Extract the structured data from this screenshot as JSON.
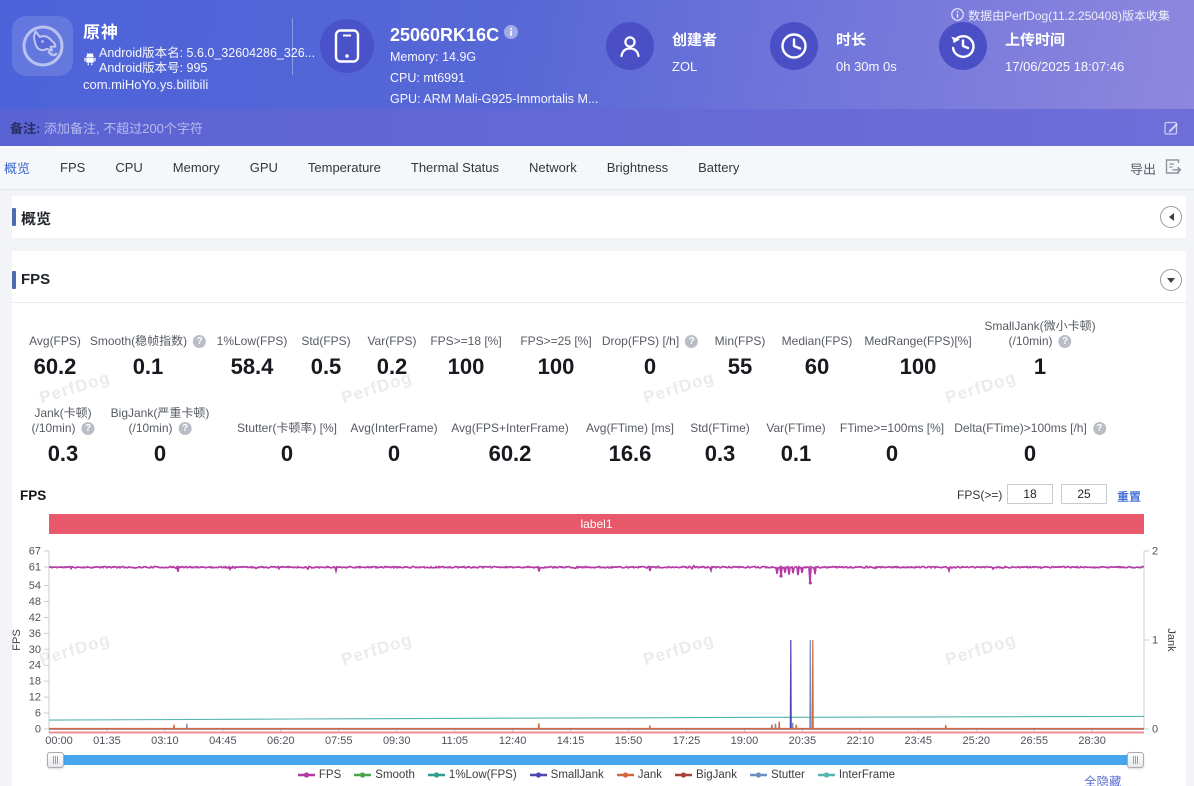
{
  "header": {
    "app": {
      "name": "原神",
      "android_version_name": "Android版本名: 5.6.0_32604286_326...",
      "android_version_code": "Android版本号: 995",
      "package": "com.miHoYo.ys.bilibili"
    },
    "device": {
      "model": "25060RK16C",
      "memory": "Memory: 14.9G",
      "cpu": "CPU: mt6991",
      "gpu": "GPU: ARM Mali-G925-Immortalis M..."
    },
    "creator": {
      "label": "创建者",
      "value": "ZOL"
    },
    "duration": {
      "label": "时长",
      "value": "0h 30m 0s"
    },
    "upload_time": {
      "label": "上传时间",
      "value": "17/06/2025 18:07:46"
    },
    "collect_note": "数据由PerfDog(11.2.250408)版本收集"
  },
  "remark": {
    "label": "备注:",
    "placeholder": "添加备注, 不超过200个字符"
  },
  "tabs": {
    "items": [
      "概览",
      "FPS",
      "CPU",
      "Memory",
      "GPU",
      "Temperature",
      "Thermal Status",
      "Network",
      "Brightness",
      "Battery"
    ],
    "active": "概览",
    "export_label": "导出"
  },
  "sections": {
    "overview_title": "概览",
    "fps_title": "FPS"
  },
  "stats": {
    "row1": [
      {
        "cx": 55,
        "label": "Avg(FPS)",
        "value": "60.2"
      },
      {
        "cx": 148,
        "label": "Smooth(稳帧指数)",
        "help": true,
        "value": "0.1"
      },
      {
        "cx": 252,
        "label": "1%Low(FPS)",
        "value": "58.4"
      },
      {
        "cx": 326,
        "label": "Std(FPS)",
        "value": "0.5"
      },
      {
        "cx": 392,
        "label": "Var(FPS)",
        "value": "0.2"
      },
      {
        "cx": 466,
        "label": "FPS>=18 [%]",
        "value": "100"
      },
      {
        "cx": 556,
        "label": "FPS>=25 [%]",
        "value": "100"
      },
      {
        "cx": 650,
        "label": "Drop(FPS) [/h]",
        "help": true,
        "value": "0"
      },
      {
        "cx": 740,
        "label": "Min(FPS)",
        "value": "55"
      },
      {
        "cx": 817,
        "label": "Median(FPS)",
        "value": "60"
      },
      {
        "cx": 918,
        "label": "MedRange(FPS)[%]",
        "value": "100"
      },
      {
        "cx": 1040,
        "label": "SmallJank(微小卡顿)",
        "label2": "(/10min)",
        "help": true,
        "value": "1"
      }
    ],
    "row2": [
      {
        "cx": 63,
        "label": "Jank(卡顿)",
        "label2": "(/10min)",
        "help": true,
        "value": "0.3"
      },
      {
        "cx": 160,
        "label": "BigJank(严重卡顿)",
        "label2": "(/10min)",
        "help": true,
        "value": "0"
      },
      {
        "cx": 287,
        "label": "Stutter(卡顿率) [%]",
        "value": "0"
      },
      {
        "cx": 394,
        "label": "Avg(InterFrame)",
        "value": "0"
      },
      {
        "cx": 510,
        "label": "Avg(FPS+InterFrame)",
        "value": "60.2"
      },
      {
        "cx": 630,
        "label": "Avg(FTime) [ms]",
        "value": "16.6"
      },
      {
        "cx": 720,
        "label": "Std(FTime)",
        "value": "0.3"
      },
      {
        "cx": 796,
        "label": "Var(FTime)",
        "value": "0.1"
      },
      {
        "cx": 892,
        "label": "FTime>=100ms [%]",
        "value": "0"
      },
      {
        "cx": 1030,
        "label": "Delta(FTime)>100ms [/h]",
        "help": true,
        "value": "0"
      }
    ]
  },
  "fps_chart": {
    "title": "FPS",
    "threshold_label": "FPS(>=)",
    "threshold1": "18",
    "threshold2": "25",
    "reset_label": "重置",
    "hide_all_label": "全隐藏"
  },
  "watermark": "PerfDog",
  "chart_data": {
    "type": "line",
    "title": "label1",
    "region_band": {
      "label": "label1",
      "color": "#e85a6b",
      "underline_color": "#ec8f9b"
    },
    "x_axis": {
      "unit": "mm:ss",
      "duration_seconds": 1795,
      "tick_interval_seconds": 95,
      "tick_labels": [
        "00:00",
        "01:35",
        "03:10",
        "04:45",
        "06:20",
        "07:55",
        "09:30",
        "11:05",
        "12:40",
        "14:15",
        "15:50",
        "17:25",
        "19:00",
        "20:35",
        "22:10",
        "23:45",
        "25:20",
        "26:55",
        "28:30"
      ]
    },
    "y_left": {
      "name": "FPS",
      "min": 0,
      "max": 67,
      "ticks": [
        0,
        6,
        12,
        18,
        24,
        30,
        36,
        42,
        48,
        54,
        61,
        67
      ]
    },
    "y_right": {
      "name": "Jank",
      "min": 0,
      "max": 2,
      "ticks": [
        0,
        1,
        2
      ]
    },
    "legend_position": "bottom",
    "grid": false,
    "series": [
      {
        "name": "FPS",
        "color": "#b43aa4",
        "axis": "left",
        "kind": "noisy",
        "baseline": 60.9,
        "noise": 0.5,
        "dips": [
          [
            212,
            59.2
          ],
          [
            470,
            59.5
          ],
          [
            803,
            59.3
          ],
          [
            985,
            59.5
          ],
          [
            1085,
            59.7
          ],
          [
            1193,
            58.4
          ],
          [
            1200,
            57.6
          ],
          [
            1206,
            58.8
          ],
          [
            1213,
            58.1
          ],
          [
            1220,
            58.7
          ],
          [
            1228,
            57.9
          ],
          [
            1235,
            58.8
          ],
          [
            1248,
            55
          ],
          [
            1256,
            58.3
          ],
          [
            1476,
            59.6
          ]
        ]
      },
      {
        "name": "Smooth",
        "color": "#4aa44e",
        "axis": "left",
        "kind": "flat",
        "value": 0.12
      },
      {
        "name": "1%Low(FPS)",
        "color": "#2d9e8f",
        "axis": "left",
        "kind": "flat",
        "value": 0.02
      },
      {
        "name": "SmallJank",
        "color": "#4b46b2",
        "axis": "right",
        "kind": "flat",
        "value": 0,
        "spikes": [
          [
            1216,
            1
          ]
        ]
      },
      {
        "name": "Jank",
        "color": "#d2693e",
        "axis": "right",
        "kind": "flat",
        "value": 0.006,
        "spikes": [
          [
            1252,
            1
          ]
        ],
        "bumps": [
          [
            205,
            0.05
          ],
          [
            803,
            0.065
          ],
          [
            985,
            0.04
          ],
          [
            1185,
            0.05
          ],
          [
            1197,
            0.085
          ],
          [
            1225,
            0.05
          ],
          [
            1470,
            0.045
          ]
        ]
      },
      {
        "name": "BigJank",
        "color": "#a8403a",
        "axis": "right",
        "kind": "flat",
        "value": 0.003
      },
      {
        "name": "Stutter",
        "color": "#6d8fc0",
        "axis": "right",
        "kind": "flat",
        "value": 0,
        "spikes": [
          [
            1248,
            1
          ]
        ],
        "bumps": [
          [
            226,
            0.06
          ],
          [
            1191,
            0.06
          ],
          [
            1219,
            0.07
          ]
        ]
      },
      {
        "name": "InterFrame",
        "color": "#53b4b0",
        "axis": "left",
        "kind": "points",
        "points": [
          [
            0,
            3.35
          ],
          [
            400,
            3.75
          ],
          [
            800,
            4.1
          ],
          [
            1200,
            4.4
          ],
          [
            1795,
            4.75
          ]
        ]
      }
    ]
  }
}
